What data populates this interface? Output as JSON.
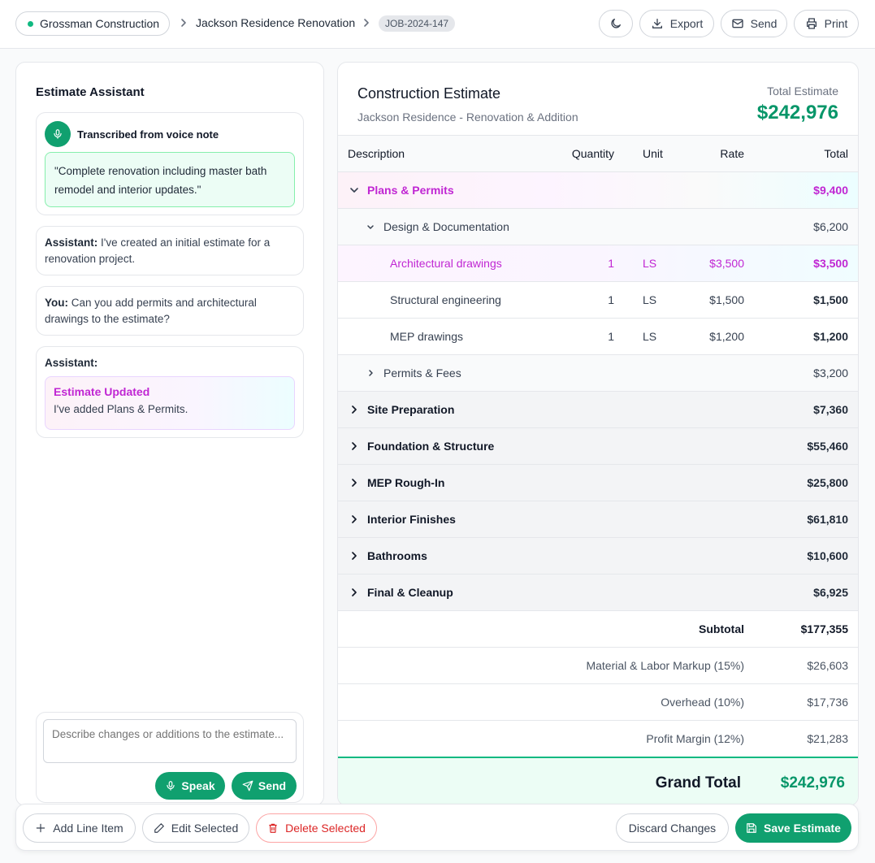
{
  "header": {
    "company": "Grossman Construction",
    "project": "Jackson Residence Renovation",
    "job_id": "JOB-2024-147",
    "buttons": {
      "export": "Export",
      "send": "Send",
      "print": "Print"
    }
  },
  "assistant": {
    "title": "Estimate Assistant",
    "voice_heading": "Transcribed from voice note",
    "voice_quote": "\"Complete renovation including master bath remodel and interior updates.\"",
    "messages": [
      {
        "speaker": "Assistant:",
        "text": "I've created an initial estimate for a renovation project."
      },
      {
        "speaker": "You:",
        "text": "Can you add permits and architectural drawings to the estimate?"
      },
      {
        "speaker": "Assistant:",
        "text": ""
      }
    ],
    "update_title": "Estimate Updated",
    "update_body": "I've added Plans & Permits.",
    "input_placeholder": "Describe changes or additions to the estimate...",
    "speak_label": "Speak",
    "send_label": "Send"
  },
  "estimate": {
    "title": "Construction Estimate",
    "subtitle": "Jackson Residence - Renovation & Addition",
    "total_label": "Total Estimate",
    "total_value": "$242,976",
    "columns": {
      "description": "Description",
      "quantity": "Quantity",
      "unit": "Unit",
      "rate": "Rate",
      "total": "Total"
    },
    "plans": {
      "label": "Plans & Permits",
      "total": "$9,400"
    },
    "design": {
      "label": "Design & Documentation",
      "total": "$6,200"
    },
    "items": [
      {
        "label": "Architectural drawings",
        "qty": "1",
        "unit": "LS",
        "rate": "$3,500",
        "total": "$3,500"
      },
      {
        "label": "Structural engineering",
        "qty": "1",
        "unit": "LS",
        "rate": "$1,500",
        "total": "$1,500"
      },
      {
        "label": "MEP drawings",
        "qty": "1",
        "unit": "LS",
        "rate": "$1,200",
        "total": "$1,200"
      }
    ],
    "permits": {
      "label": "Permits & Fees",
      "total": "$3,200"
    },
    "categories": [
      {
        "label": "Site Preparation",
        "total": "$7,360"
      },
      {
        "label": "Foundation & Structure",
        "total": "$55,460"
      },
      {
        "label": "MEP Rough-In",
        "total": "$25,800"
      },
      {
        "label": "Interior Finishes",
        "total": "$61,810"
      },
      {
        "label": "Bathrooms",
        "total": "$10,600"
      },
      {
        "label": "Final & Cleanup",
        "total": "$6,925"
      }
    ],
    "subtotal_label": "Subtotal",
    "subtotal": "$177,355",
    "markup_label": "Material & Labor Markup (15%)",
    "markup": "$26,603",
    "overhead_label": "Overhead (10%)",
    "overhead": "$17,736",
    "profit_label": "Profit Margin (12%)",
    "profit": "$21,283",
    "grand_label": "Grand Total",
    "grand_total": "$242,976"
  },
  "toolbar": {
    "add": "Add Line Item",
    "edit": "Edit Selected",
    "delete": "Delete Selected",
    "discard": "Discard Changes",
    "save": "Save Estimate"
  },
  "colors": {
    "accent": "#10a06f",
    "highlight": "#c026d3",
    "danger": "#dc2626"
  }
}
